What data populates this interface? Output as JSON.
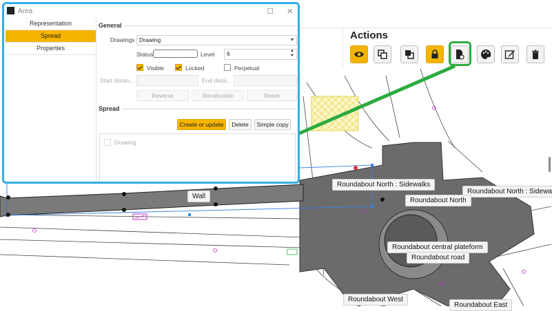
{
  "map": {
    "labels": {
      "wall": "Wall",
      "rb_north_sidewalks": "Roundabout North : Sidewalks",
      "rb_north_sidewa": "Roundabout North : Sidewa",
      "rb_north": "Roundabout North",
      "rb_central": "Roundabout central plateform",
      "rb_road": "Roundabout road",
      "rb_west": "Roundabout West",
      "rb_east": "Roundabout East"
    }
  },
  "actions": {
    "title": "Actions",
    "buttons": [
      {
        "icon": "eye-icon",
        "active": true
      },
      {
        "icon": "bring-forward-icon",
        "active": false
      },
      {
        "icon": "send-backward-icon",
        "active": false
      },
      {
        "icon": "lock-icon",
        "active": true
      },
      {
        "icon": "spread-document-icon",
        "active": false
      },
      {
        "icon": "palette-icon",
        "active": false
      },
      {
        "icon": "edit-icon",
        "active": false
      },
      {
        "icon": "trash-icon",
        "active": false
      }
    ],
    "highlight_color": "#2cab3f"
  },
  "dialog": {
    "title": "Area",
    "nav": [
      "Representation",
      "Spread",
      "Properties"
    ],
    "selected_nav": "Spread",
    "general": {
      "title": "General",
      "drawings_label": "Drawings",
      "drawings_value": "Drawing",
      "status_label": "Status",
      "status_value": "",
      "level_label": "Level",
      "level_value": "6",
      "visible_label": "Visible",
      "visible_checked": true,
      "locked_label": "Locked",
      "locked_checked": true,
      "perpetual_label": "Perpetual",
      "perpetual_checked": false,
      "start_label": "Start distan...",
      "end_label": "End dista...",
      "reverse_label": "Reverse",
      "recalculate_label": "Recalculate",
      "reset_label": "Reset"
    },
    "spread": {
      "title": "Spread",
      "create_label": "Create or update",
      "delete_label": "Delete",
      "simple_copy_label": "Simple copy",
      "list_items": [
        "Drawing"
      ]
    },
    "accent_color": "#f5b400",
    "border_color": "#31aee4"
  }
}
